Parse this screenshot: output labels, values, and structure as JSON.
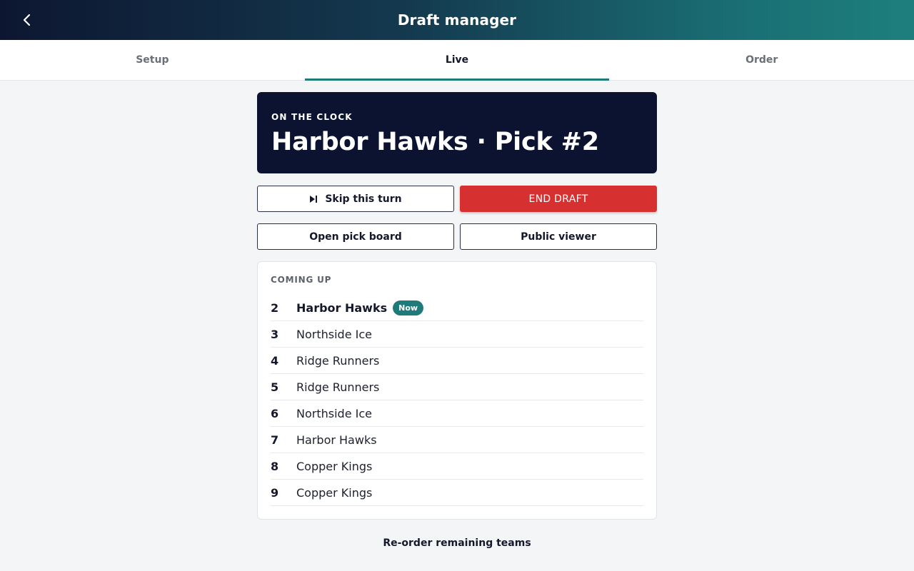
{
  "header": {
    "title": "Draft manager",
    "back_icon": "chevron-left-icon"
  },
  "tabs": [
    {
      "label": "Setup",
      "active": false
    },
    {
      "label": "Live",
      "active": true
    },
    {
      "label": "Order",
      "active": false
    }
  ],
  "on_clock": {
    "kicker": "ON THE CLOCK",
    "title": "Harbor Hawks · Pick #2"
  },
  "actions": {
    "skip_label": "Skip this turn",
    "skip_icon": "skip-next-icon",
    "end_label": "END DRAFT",
    "pick_board_label": "Open pick board",
    "public_viewer_label": "Public viewer"
  },
  "coming_up": {
    "label": "COMING UP",
    "now_badge": "Now",
    "picks": [
      {
        "num": "2",
        "team": "Harbor Hawks",
        "current": true
      },
      {
        "num": "3",
        "team": "Northside Ice",
        "current": false
      },
      {
        "num": "4",
        "team": "Ridge Runners",
        "current": false
      },
      {
        "num": "5",
        "team": "Ridge Runners",
        "current": false
      },
      {
        "num": "6",
        "team": "Northside Ice",
        "current": false
      },
      {
        "num": "7",
        "team": "Harbor Hawks",
        "current": false
      },
      {
        "num": "8",
        "team": "Copper Kings",
        "current": false
      },
      {
        "num": "9",
        "team": "Copper Kings",
        "current": false
      }
    ]
  },
  "reorder_label": "Re-order remaining teams",
  "colors": {
    "accent": "#1f7b7a",
    "danger": "#d63031",
    "navy": "#0b1330"
  }
}
